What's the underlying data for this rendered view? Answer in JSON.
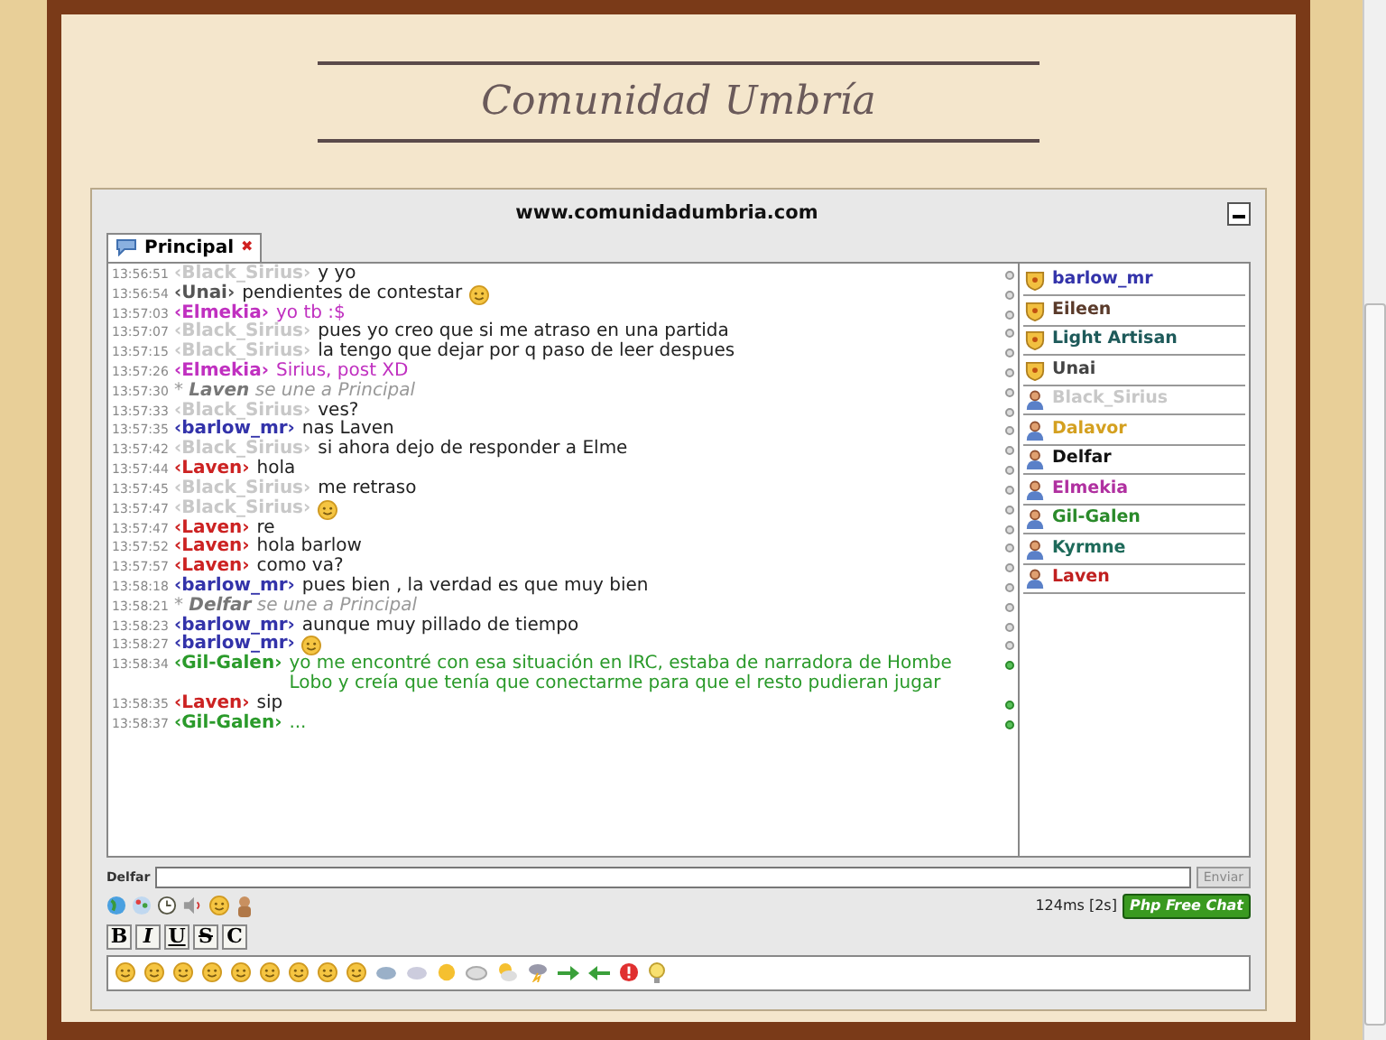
{
  "site_title": "Comunidad Umbría",
  "chat": {
    "url": "www.comunidadumbria.com",
    "tabs": [
      {
        "label": "Principal",
        "close": "✖",
        "selected": true
      }
    ],
    "messages": [
      {
        "time": "13:56:51",
        "nick": "‹Black_Sirius›",
        "color": "#c8c8c8",
        "kind": "message",
        "text": "y yo",
        "smiley": false,
        "highlighted": false
      },
      {
        "time": "13:56:54",
        "nick": "‹Unai›",
        "color": "#555555",
        "kind": "message",
        "text": "pendientes de contestar",
        "smiley": true,
        "highlighted": false
      },
      {
        "time": "13:57:03",
        "nick": "‹Elmekia›",
        "color": "#c030c0",
        "kind": "colored",
        "text": "yo tb :$",
        "smiley": false,
        "highlighted": false
      },
      {
        "time": "13:57:07",
        "nick": "‹Black_Sirius›",
        "color": "#c8c8c8",
        "kind": "message",
        "text": "pues yo creo que si me atraso en una partida",
        "smiley": false,
        "highlighted": false
      },
      {
        "time": "13:57:15",
        "nick": "‹Black_Sirius›",
        "color": "#c8c8c8",
        "kind": "message",
        "text": "la tengo que dejar por q paso de leer despues",
        "smiley": false,
        "highlighted": false
      },
      {
        "time": "13:57:26",
        "nick": "‹Elmekia›",
        "color": "#c030c0",
        "kind": "colored",
        "text": "Sirius, post XD",
        "smiley": false,
        "highlighted": false
      },
      {
        "time": "13:57:30",
        "marker": "*",
        "nick": "Laven",
        "kind": "join",
        "text": "se une a Principal",
        "highlighted": false
      },
      {
        "time": "13:57:33",
        "nick": "‹Black_Sirius›",
        "color": "#c8c8c8",
        "kind": "message",
        "text": "ves?",
        "smiley": false,
        "highlighted": false
      },
      {
        "time": "13:57:35",
        "nick": "‹barlow_mr›",
        "color": "#3333aa",
        "kind": "message",
        "text": "nas Laven",
        "smiley": false,
        "highlighted": false
      },
      {
        "time": "13:57:42",
        "nick": "‹Black_Sirius›",
        "color": "#c8c8c8",
        "kind": "message",
        "text": "si ahora dejo de responder a Elme",
        "smiley": false,
        "highlighted": false
      },
      {
        "time": "13:57:44",
        "nick": "‹Laven›",
        "color": "#cc2222",
        "kind": "message",
        "text": "hola",
        "smiley": false,
        "highlighted": false
      },
      {
        "time": "13:57:45",
        "nick": "‹Black_Sirius›",
        "color": "#c8c8c8",
        "kind": "message",
        "text": "me retraso",
        "smiley": false,
        "highlighted": false
      },
      {
        "time": "13:57:47",
        "nick": "‹Black_Sirius›",
        "color": "#c8c8c8",
        "kind": "message",
        "smiley": true,
        "highlighted": false
      },
      {
        "time": "13:57:47",
        "nick": "‹Laven›",
        "color": "#cc2222",
        "kind": "message",
        "text": "re",
        "smiley": false,
        "highlighted": false
      },
      {
        "time": "13:57:52",
        "nick": "‹Laven›",
        "color": "#cc2222",
        "kind": "message",
        "text": "hola barlow",
        "smiley": false,
        "highlighted": false
      },
      {
        "time": "13:57:57",
        "nick": "‹Laven›",
        "color": "#cc2222",
        "kind": "message",
        "text": "como va?",
        "smiley": false,
        "highlighted": false
      },
      {
        "time": "13:58:18",
        "nick": "‹barlow_mr›",
        "color": "#3333aa",
        "kind": "message",
        "text": "pues bien , la verdad es que muy bien",
        "smiley": false,
        "highlighted": false
      },
      {
        "time": "13:58:21",
        "marker": "*",
        "nick": "Delfar",
        "kind": "join",
        "text": "se une a Principal",
        "highlighted": false
      },
      {
        "time": "13:58:23",
        "nick": "‹barlow_mr›",
        "color": "#3333aa",
        "kind": "message",
        "text": "aunque muy pillado de tiempo",
        "smiley": false,
        "highlighted": false
      },
      {
        "time": "13:58:27",
        "nick": "‹barlow_mr›",
        "color": "#3333aa",
        "kind": "message",
        "smiley": true,
        "highlighted": false
      },
      {
        "time": "13:58:34",
        "nick": "‹Gil-Galen›",
        "color": "#2a9a2a",
        "kind": "colored",
        "text": "yo me encontré con esa situación en IRC, estaba de narradora de Hombe Lobo y creía que tenía que conectarme para que el resto pudieran jugar",
        "smiley": false,
        "highlighted": true
      },
      {
        "time": "13:58:35",
        "nick": "‹Laven›",
        "color": "#cc2222",
        "kind": "message",
        "text": "sip",
        "smiley": false,
        "highlighted": true
      },
      {
        "time": "13:58:37",
        "nick": "‹Gil-Galen›",
        "color": "#2a9a2a",
        "kind": "colored",
        "text": "...",
        "smiley": false,
        "highlighted": true
      }
    ],
    "users": [
      {
        "name": "barlow_mr",
        "color": "#3333aa",
        "kind": "moderator"
      },
      {
        "name": "Eileen",
        "color": "#5a3a2a",
        "kind": "moderator"
      },
      {
        "name": "Light Artisan",
        "color": "#1e5a5a",
        "kind": "moderator"
      },
      {
        "name": "Unai",
        "color": "#444444",
        "kind": "moderator"
      },
      {
        "name": "Black_Sirius",
        "color": "#c8c8c8",
        "kind": "user"
      },
      {
        "name": "Dalavor",
        "color": "#d4a020",
        "kind": "user"
      },
      {
        "name": "Delfar",
        "color": "#111111",
        "kind": "user"
      },
      {
        "name": "Elmekia",
        "color": "#b030a0",
        "kind": "user"
      },
      {
        "name": "Gil-Galen",
        "color": "#2a8a2a",
        "kind": "user"
      },
      {
        "name": "Kyrmne",
        "color": "#1e6a5a",
        "kind": "user"
      },
      {
        "name": "Laven",
        "color": "#c02020",
        "kind": "user"
      }
    ],
    "input_label": "Delfar",
    "send_button": "Enviar",
    "ping": "124ms [2s]",
    "badge": "Php Free Chat",
    "format_buttons": [
      "B",
      "I",
      "U",
      "S",
      "C"
    ]
  }
}
